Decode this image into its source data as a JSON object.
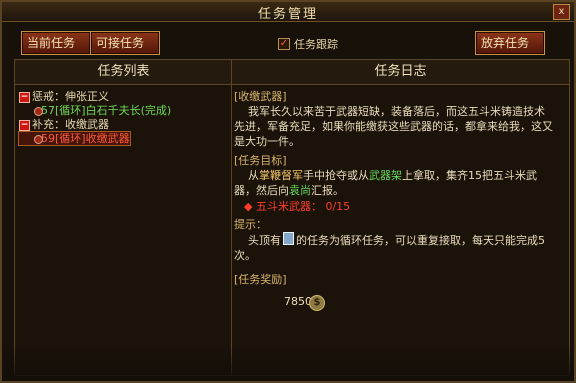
{
  "window": {
    "title": "任务管理",
    "close_label": "x"
  },
  "toolbar": {
    "current_tasks": "当前任务",
    "available_tasks": "可接任务",
    "track_label": "任务跟踪",
    "abandon_label": "放弃任务"
  },
  "list_panel": {
    "header": "任务列表",
    "groups": [
      {
        "label": "惩戒：伸张正义",
        "children": [
          {
            "label": "57[循环]白石千夫长(完成)"
          }
        ]
      },
      {
        "label": "补充：收缴武器",
        "children": [
          {
            "label": "59[循环]收缴武器"
          }
        ]
      }
    ]
  },
  "log_panel": {
    "header": "任务日志",
    "section1_title": "[收缴武器]",
    "section1_text": "我军长久以来苦于武器短缺，装备落后，而这五斗米铸造技术先进，军备充足，如果你能缴获这些武器的话，都拿来给我，这又是大功一件。",
    "section2_title": "[任务目标]",
    "section2_part1": "从",
    "section2_keyword1": "掌鞭督军",
    "section2_part2": "手中抢夺或从",
    "section2_keyword2": "武器架",
    "section2_part3": "上拿取，集齐15把五斗米武器，然后向",
    "section2_keyword3": "袁尚",
    "section2_part4": "汇报。",
    "requirement": "◆  五斗米武器：  0/15",
    "hint_title": "提示：",
    "hint_text1": "头顶有",
    "hint_text2": "的任务为循环任务，可以重复接取，每天只能完成5次。",
    "reward_title": "[任务奖励]",
    "reward_value": "7850"
  },
  "colors": {
    "accent": "#c39445",
    "button": "#7c2a12",
    "green": "#6fd858",
    "red": "#ff3e2a"
  },
  "icons": [
    "close-icon",
    "minus-icon",
    "cycle-icon",
    "coin-icon"
  ]
}
